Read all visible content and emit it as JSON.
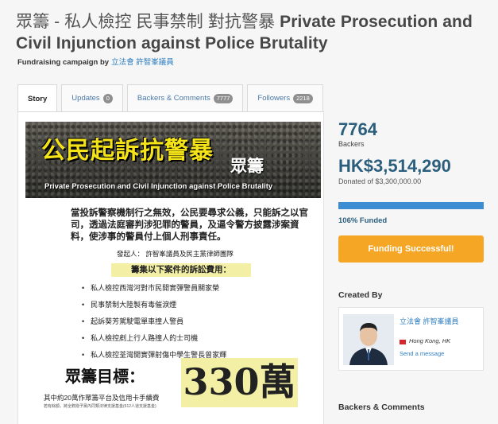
{
  "campaign": {
    "title_zh": "眾籌 - 私人檢控 民事禁制 對抗警暴",
    "title_en": "Private Prosecution and Civil Injunction against Police Brutality",
    "subtitle_prefix": "Fundraising campaign by",
    "owner": "立法會 許智峯議員"
  },
  "tabs": [
    {
      "label": "Story"
    },
    {
      "label": "Updates",
      "count": "0"
    },
    {
      "label": "Backers & Comments",
      "count": "7777"
    },
    {
      "label": "Followers",
      "count": "2218"
    }
  ],
  "story": {
    "banner_title": "公民起訴抗警暴",
    "banner_sub": "眾籌",
    "banner_en": "Private Prosecution and Civil Injunction against Police Brutality",
    "paragraph": "當投訴警察機制行之無效，公民要尋求公義，只能訴之以官司，透過法庭審判涉犯罪的警員，及逼令警方披露涉案資料，使涉事的警員付上個人刑事責任。",
    "signatory": "發起人：   許智峯議員及民主黨律師團隊",
    "cases_heading": "籌集以下案件的訴訟費用：",
    "cases": [
      "私人檢控西灣河對市民開實彈警員關家榮",
      "民事禁制大陸製有毒催淚煙",
      "起訴葵芳駕駛電單車撞人警員",
      "私人檢控剷上行人路撞人的士司機",
      "私人檢控荃灣開實彈射傷中學生警長曾家輝"
    ],
    "target_label": "眾籌目標：",
    "target_amount": "330萬",
    "note_main": "其中約20萬作眾籌平台及信用卡手續費",
    "note_small": "若有餘額，將全數撥予黨內同類法律支援基金(612人道支援基金)"
  },
  "sidebar": {
    "backers": "7764",
    "backers_label": "Backers",
    "amount": "HK$3,514,290",
    "donated_of": "Donated of $3,300,000.00",
    "funded_percent": 106,
    "funded_label": "106% Funded",
    "button": "Funding Successful!",
    "created_by": "Created By",
    "owner_name": "立法會 許智峯議員",
    "location": "Hong Kong, HK",
    "send_message": "Send a message",
    "backers_comments": "Backers & Comments"
  },
  "colors": {
    "accent_blue": "#2b5f7d",
    "link_blue": "#2d7dbf",
    "progress": "#3c8dd2",
    "button_orange": "#f5a624",
    "highlight_yellow": "#f3f0a6"
  }
}
